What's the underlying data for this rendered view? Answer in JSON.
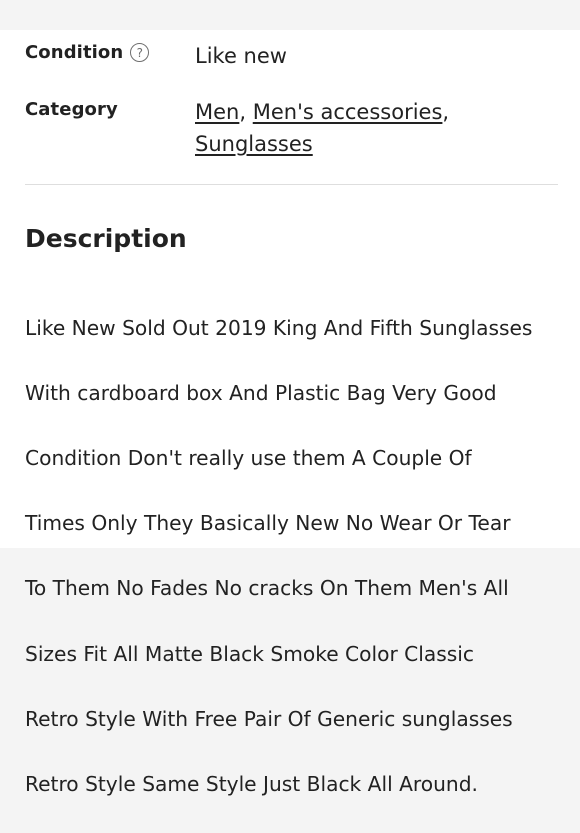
{
  "details": {
    "condition": {
      "label": "Condition",
      "help_icon": "?",
      "value": "Like new"
    },
    "category": {
      "label": "Category",
      "links": [
        {
          "text": "Men"
        },
        {
          "text": "Men's accessories"
        },
        {
          "text": "Sunglasses"
        }
      ],
      "separator": ","
    }
  },
  "description": {
    "heading": "Description",
    "lines": [
      "Like New Sold Out 2019 King And Fifth Sunglasses",
      "With cardboard box And Plastic Bag Very Good",
      "Condition  Don't really use them A Couple Of",
      "Times Only They Basically New No Wear Or Tear",
      "To Them No Fades No cracks  On Them Men's All",
      "Sizes Fit All  Matte Black Smoke Color Classic",
      "Retro Style With Free Pair Of Generic sunglasses",
      "Retro Style Same Style Just Black All Around."
    ]
  },
  "colors": {
    "background": "#f4f4f4",
    "card": "#ffffff",
    "text": "#222222",
    "divider": "#dedede"
  },
  "icons": {
    "help": "question-circle-icon"
  }
}
